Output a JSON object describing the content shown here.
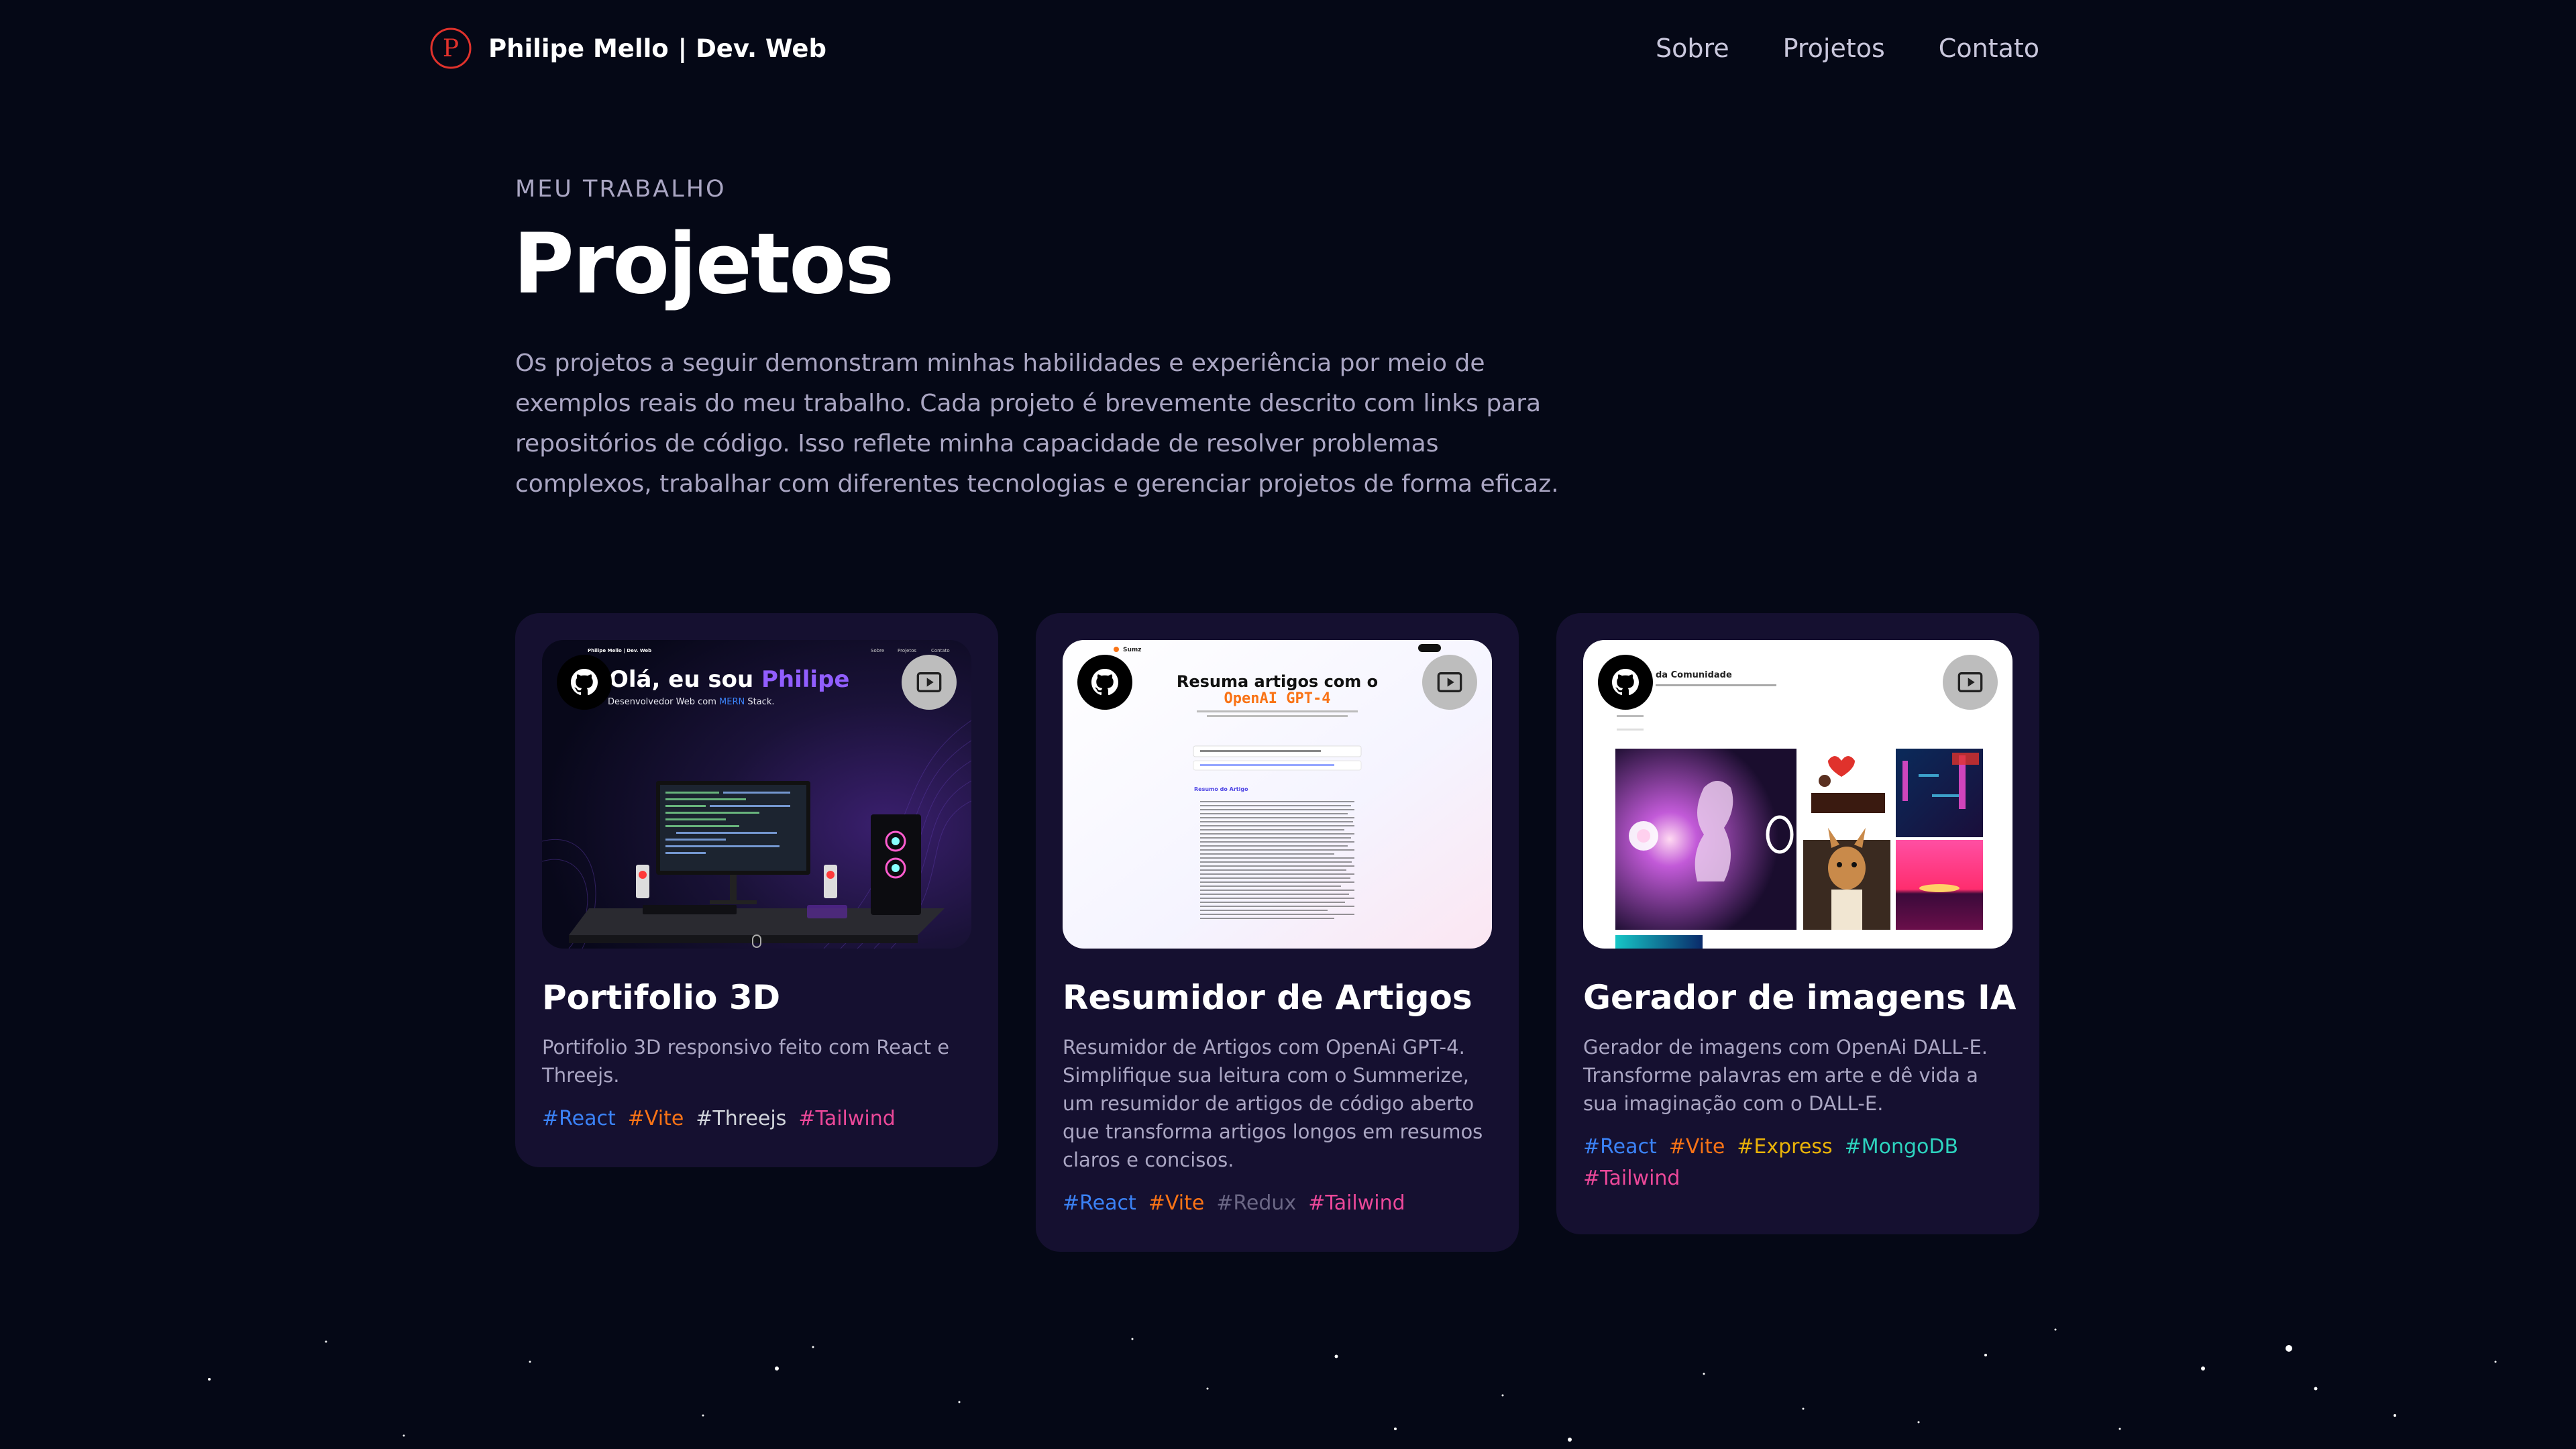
{
  "nav": {
    "logo_letter": "P",
    "name": "Philipe Mello",
    "suffix": "| Dev. Web",
    "links": [
      "Sobre",
      "Projetos",
      "Contato"
    ]
  },
  "hero": {
    "overline": "MEU TRABALHO",
    "title": "Projetos",
    "description": "Os projetos a seguir demonstram minhas habilidades e experiência por meio de exemplos reais do meu trabalho. Cada projeto é brevemente descrito com links para repositórios de código. Isso reflete minha capacidade de resolver problemas complexos, trabalhar com diferentes tecnologias e gerenciar projetos de forma eficaz."
  },
  "icons": {
    "github": "github-icon",
    "video": "play-video-icon"
  },
  "colors": {
    "background": "#050816",
    "card": "#151030",
    "text_secondary": "#aaa6c3",
    "accent_purple": "#915eff",
    "logo_red": "#e0322c"
  },
  "projects": [
    {
      "title": "Portifolio 3D",
      "description": "Portifolio 3D responsivo feito com React e Threejs.",
      "preview": {
        "nav_name": "Philipe Mello | Dev. Web",
        "nav_links": [
          "Sobre",
          "Projetos",
          "Contato"
        ],
        "heading_prefix": "Olá, eu sou ",
        "heading_name": "Philipe",
        "subtitle_prefix": "Desenvolvedor Web com ",
        "subtitle_accent": "MERN",
        "subtitle_suffix": " Stack."
      },
      "tags": [
        {
          "label": "#React",
          "color": "#3b82f6"
        },
        {
          "label": "#Vite",
          "color": "#f97316"
        },
        {
          "label": "#Threejs",
          "color": "#d1d5db"
        },
        {
          "label": "#Tailwind",
          "color": "#ec4899"
        }
      ]
    },
    {
      "title": "Resumidor de Artigos",
      "description": "Resumidor de Artigos com OpenAi GPT-4. Simplifique sua leitura com o Summerize, um resumidor de artigos de código aberto que transforma artigos longos em resumos claros e concisos.",
      "preview": {
        "brand": "Sumz",
        "heading_line1": "Resuma artigos com o",
        "heading_line2": "OpenAI GPT-4",
        "section_label": "Resumo do Artigo"
      },
      "tags": [
        {
          "label": "#React",
          "color": "#3b82f6"
        },
        {
          "label": "#Vite",
          "color": "#f97316"
        },
        {
          "label": "#Redux",
          "color": "#6b6785"
        },
        {
          "label": "#Tailwind",
          "color": "#ec4899"
        }
      ]
    },
    {
      "title": "Gerador de imagens IA",
      "description": "Gerador de imagens com OpenAi DALL-E. Transforme palavras em arte e dê vida a sua imaginação com o DALL-E.",
      "preview": {
        "heading": "da Comunidade"
      },
      "tags": [
        {
          "label": "#React",
          "color": "#3b82f6"
        },
        {
          "label": "#Vite",
          "color": "#f97316"
        },
        {
          "label": "#Express",
          "color": "#eab308"
        },
        {
          "label": "#MongoDB",
          "color": "#2dd4bf"
        },
        {
          "label": "#Tailwind",
          "color": "#ec4899"
        }
      ]
    }
  ]
}
